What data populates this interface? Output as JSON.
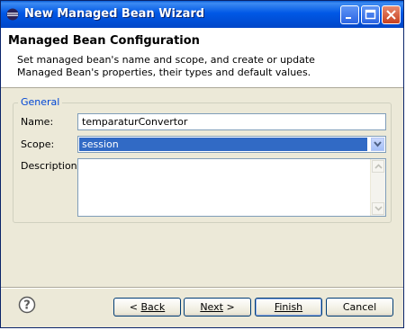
{
  "window": {
    "title": "New Managed Bean Wizard",
    "accent": "#0058e6"
  },
  "header": {
    "title": "Managed Bean Configuration",
    "description": "Set managed bean's name and scope, and create or update Managed Bean's properties, their types and default values.",
    "icon": "wizard-banner-icon"
  },
  "form": {
    "group_label": "General",
    "name_label": "Name:",
    "name_value": "temparaturConvertor",
    "scope_label": "Scope:",
    "scope_value": "session",
    "description_label": "Description:",
    "description_value": ""
  },
  "buttons": {
    "back_label": "Back",
    "back_prefix": "< ",
    "next_label": "Next",
    "next_suffix": " >",
    "finish_label": "Finish",
    "cancel_label": "Cancel"
  }
}
